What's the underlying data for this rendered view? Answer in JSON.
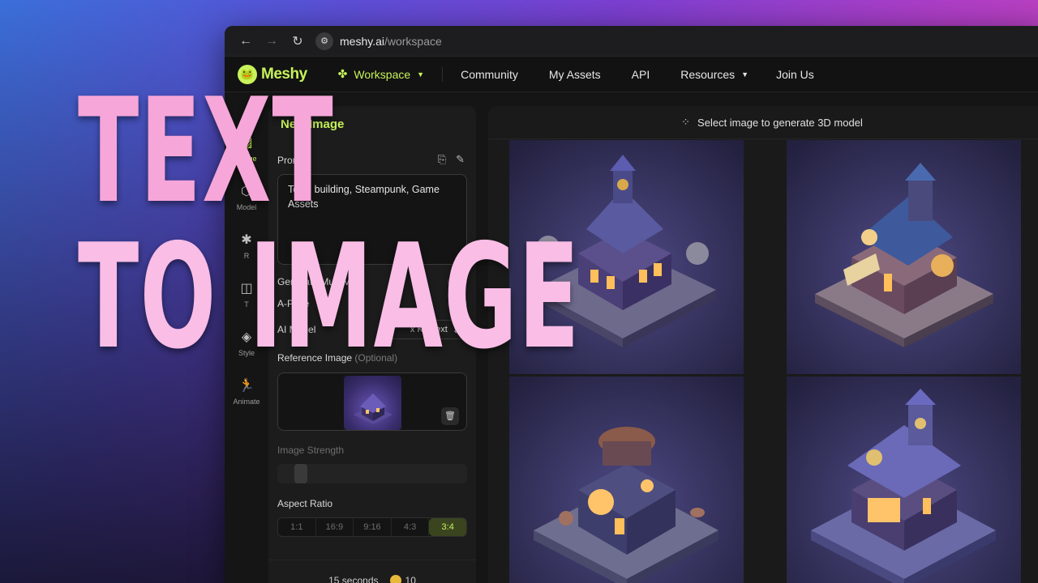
{
  "browser": {
    "back_icon": "arrow-left-icon",
    "forward_icon": "arrow-right-icon",
    "reload_icon": "reload-icon",
    "url_domain": "meshy.ai",
    "url_path": "/workspace"
  },
  "nav": {
    "logo_text": "Meshy",
    "workspace": "Workspace",
    "community": "Community",
    "my_assets": "My Assets",
    "api": "API",
    "resources": "Resources",
    "join_us": "Join Us"
  },
  "rail": {
    "items": [
      {
        "label": "Image",
        "icon": "image-icon"
      },
      {
        "label": "Model",
        "icon": "cube-icon"
      },
      {
        "label": "R",
        "icon": "remesh-icon"
      },
      {
        "label": "T",
        "icon": "texture-icon"
      },
      {
        "label": "Style",
        "icon": "style-icon"
      },
      {
        "label": "Animate",
        "icon": "running-figure-icon"
      }
    ]
  },
  "panel": {
    "title": "New Image",
    "prompt_label": "Prompt",
    "prompt_value": "Town building, Steampunk, Game Assets",
    "generate_preview_label": "Generate Multi-view",
    "pose_label": "A-Pose",
    "ai_model_label": "AI Model",
    "ai_model_value": "x Kontext",
    "reference_label": "Reference Image",
    "reference_optional": "(Optional)",
    "image_strength_label": "Image Strength",
    "aspect_ratio_label": "Aspect Ratio",
    "aspect_options": [
      "1:1",
      "16:9",
      "9:16",
      "4:3",
      "3:4"
    ],
    "aspect_selected": "3:4",
    "footer_time": "15 seconds",
    "footer_credits": "10"
  },
  "gallery": {
    "header": "Select image to generate 3D model"
  },
  "overlay": {
    "line1": "TEXT",
    "line2": "TO IMAGE"
  },
  "colors": {
    "accent": "#c7f25a",
    "overlay_pink": "#f6a6d8"
  }
}
